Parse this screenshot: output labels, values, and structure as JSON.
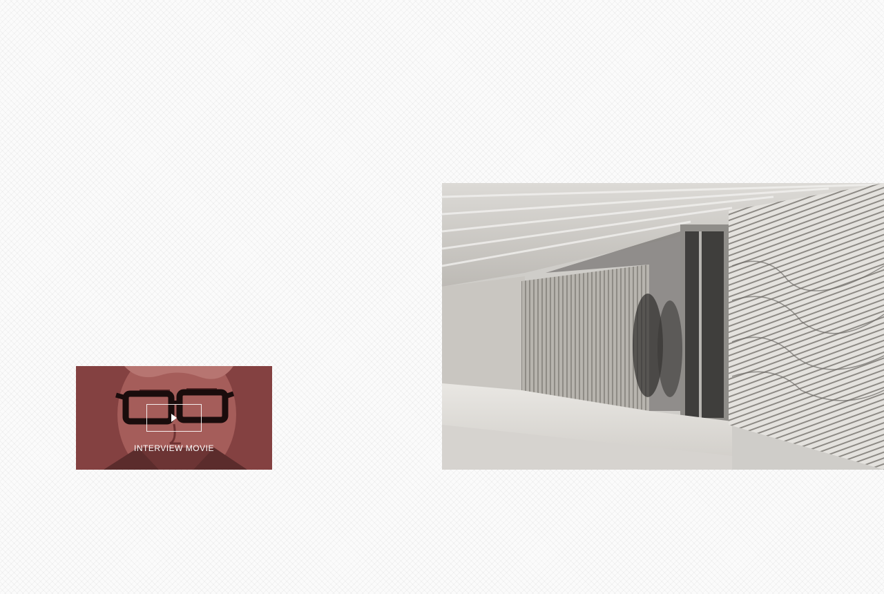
{
  "interview": {
    "label": "INTERVIEW MOVIE",
    "tint_color": "#8a4646",
    "play_icon": "play-icon"
  },
  "feature_image": {
    "subject": "gallery-entrance-photo"
  }
}
